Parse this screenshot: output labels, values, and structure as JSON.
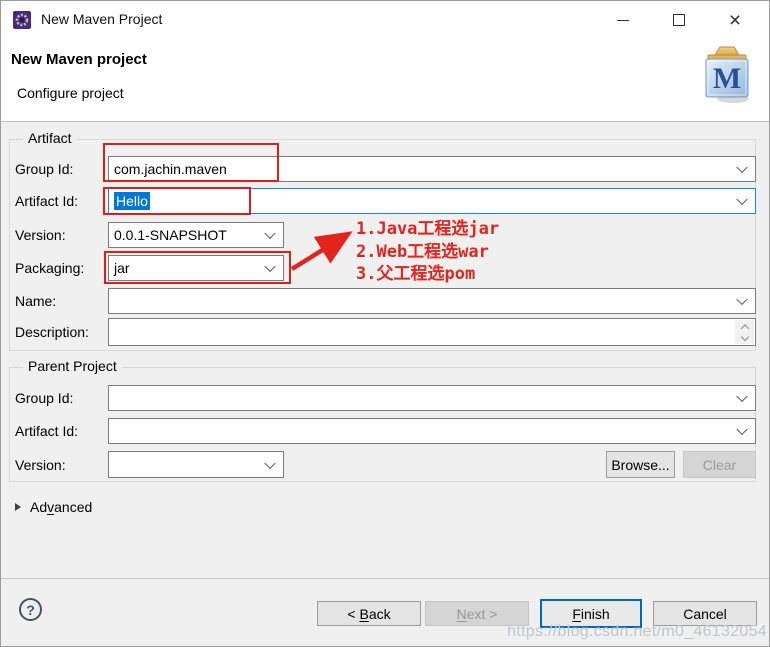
{
  "window": {
    "title": "New Maven Project"
  },
  "header": {
    "title": "New Maven project",
    "subtitle": "Configure project"
  },
  "artifact": {
    "legend": "Artifact",
    "group_id": {
      "label": "Group Id:",
      "value": "com.jachin.maven"
    },
    "artifact_id": {
      "label": "Artifact Id:",
      "value": "Hello"
    },
    "version": {
      "label": "Version:",
      "value": "0.0.1-SNAPSHOT"
    },
    "packaging": {
      "label": "Packaging:",
      "value": "jar"
    },
    "name": {
      "label": "Name:",
      "value": ""
    },
    "description": {
      "label": "Description:",
      "value": ""
    }
  },
  "annotation": {
    "lines": [
      "1.Java工程选jar",
      "2.Web工程选war",
      "3.父工程选pom"
    ]
  },
  "parent_project": {
    "legend": "Parent Project",
    "group_id": {
      "label": "Group Id:",
      "value": ""
    },
    "artifact_id": {
      "label": "Artifact Id:",
      "value": ""
    },
    "version": {
      "label": "Version:",
      "value": ""
    },
    "browse_label": "Browse...",
    "clear_label": "Clear"
  },
  "advanced": {
    "pre": "Ad",
    "mnemonic": "v",
    "post": "anced"
  },
  "footer": {
    "help": "?",
    "back": {
      "pre": "< ",
      "mnemonic": "B",
      "post": "ack"
    },
    "next": {
      "pre": "",
      "mnemonic": "N",
      "post": "ext >"
    },
    "finish": {
      "pre": "",
      "mnemonic": "F",
      "post": "inish"
    },
    "cancel": "Cancel"
  },
  "watermark": "https://blog.csdn.net/m0_46132054",
  "icons": {
    "titlebar": "wizard-icon",
    "banner": "maven-logo-icon",
    "combo": "chevron-down-icon",
    "help": "question-mark-icon",
    "advanced": "triangle-right-icon"
  },
  "colors": {
    "selection": "#0078d7",
    "focus_border": "#1a86d9",
    "annotation_red": "#e3241d",
    "finish_border": "#0067c0"
  }
}
